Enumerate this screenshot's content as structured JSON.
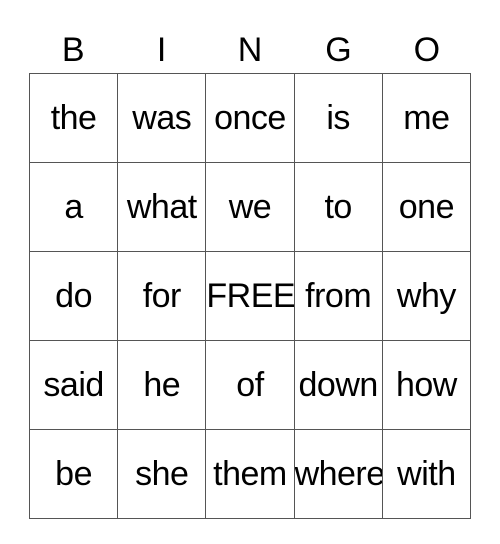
{
  "header": [
    "B",
    "I",
    "N",
    "G",
    "O"
  ],
  "rows": [
    [
      "the",
      "was",
      "once",
      "is",
      "me"
    ],
    [
      "a",
      "what",
      "we",
      "to",
      "one"
    ],
    [
      "do",
      "for",
      "FREE!",
      "from",
      "why"
    ],
    [
      "said",
      "he",
      "of",
      "down",
      "how"
    ],
    [
      "be",
      "she",
      "them",
      "where",
      "with"
    ]
  ]
}
